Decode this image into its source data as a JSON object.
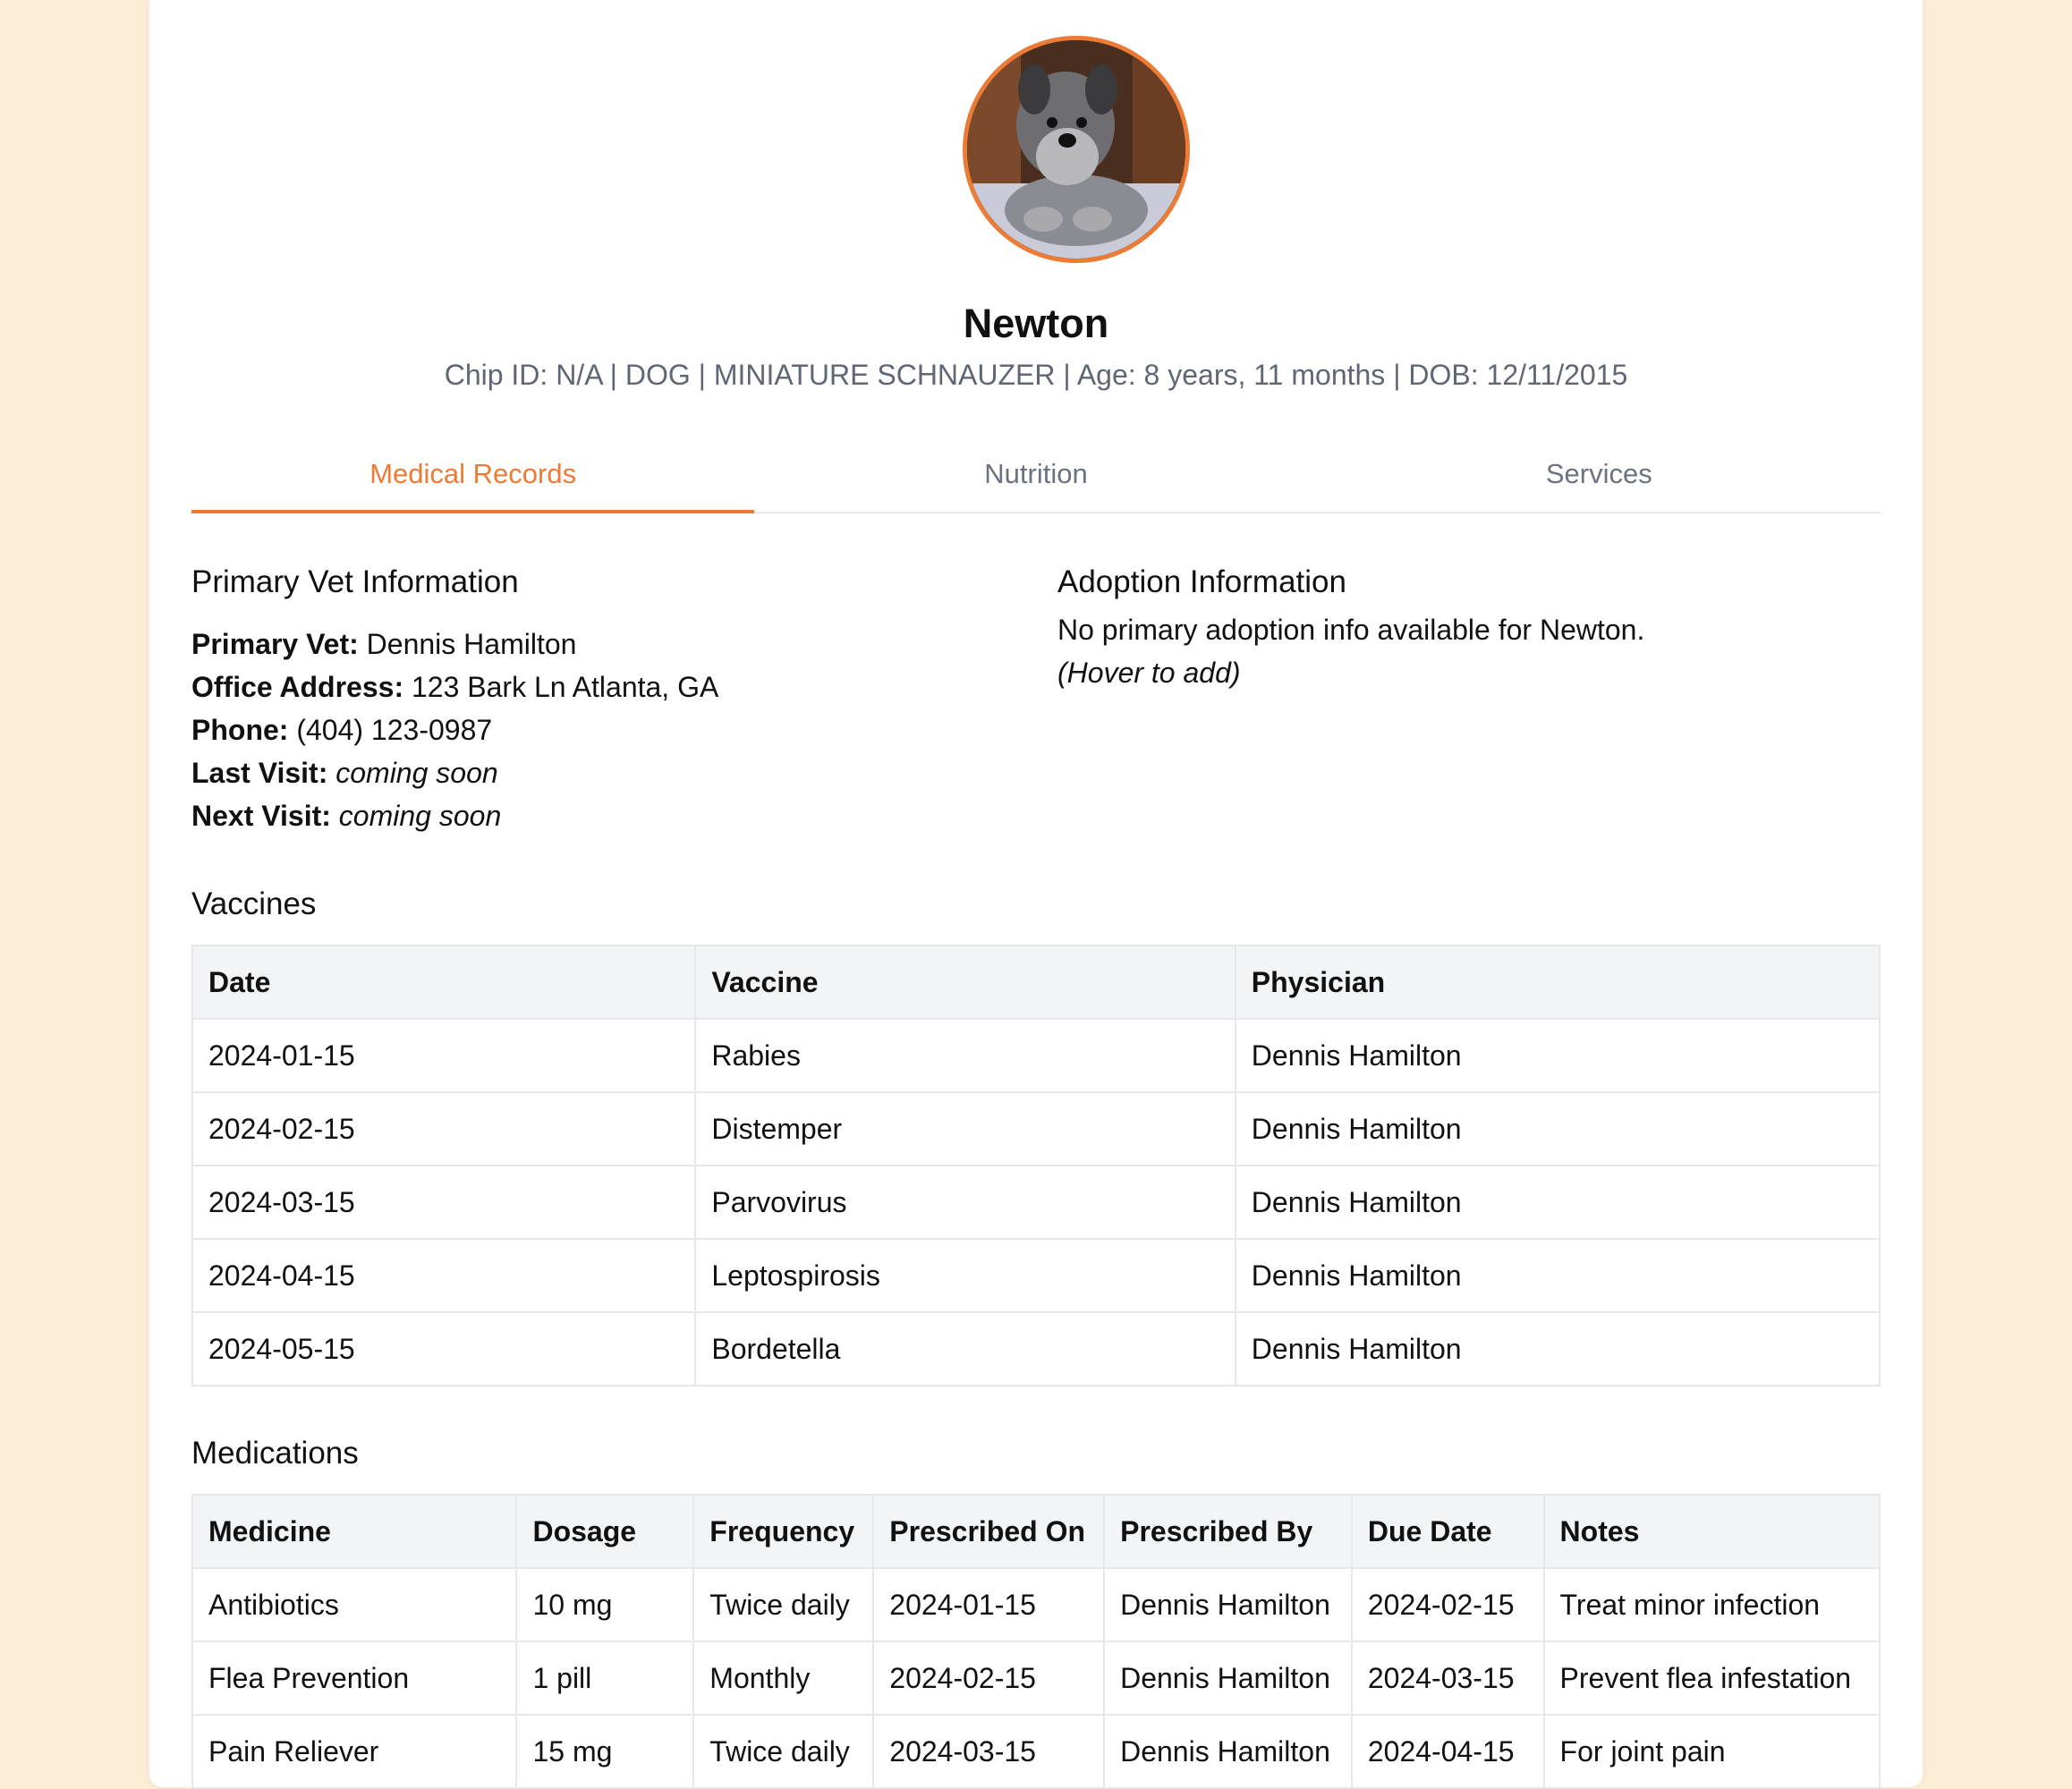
{
  "profile": {
    "name": "Newton",
    "meta": "Chip ID: N/A | DOG | MINIATURE SCHNAUZER | Age: 8 years, 11 months | DOB: 12/11/2015"
  },
  "tabs": [
    {
      "label": "Medical Records",
      "active": true
    },
    {
      "label": "Nutrition",
      "active": false
    },
    {
      "label": "Services",
      "active": false
    }
  ],
  "vet": {
    "title": "Primary Vet Information",
    "rows": [
      {
        "label": "Primary Vet:",
        "value": "Dennis Hamilton",
        "italic": false
      },
      {
        "label": "Office Address:",
        "value": "123 Bark Ln Atlanta, GA",
        "italic": false
      },
      {
        "label": "Phone:",
        "value": "(404) 123-0987",
        "italic": false
      },
      {
        "label": "Last Visit:",
        "value": "coming soon",
        "italic": true
      },
      {
        "label": "Next Visit:",
        "value": "coming soon",
        "italic": true
      }
    ]
  },
  "adoption": {
    "title": "Adoption Information",
    "message": "No primary adoption info available for Newton.",
    "hint": "(Hover to add)"
  },
  "vaccines": {
    "title": "Vaccines",
    "headers": [
      "Date",
      "Vaccine",
      "Physician"
    ],
    "rows": [
      [
        "2024-01-15",
        "Rabies",
        "Dennis Hamilton"
      ],
      [
        "2024-02-15",
        "Distemper",
        "Dennis Hamilton"
      ],
      [
        "2024-03-15",
        "Parvovirus",
        "Dennis Hamilton"
      ],
      [
        "2024-04-15",
        "Leptospirosis",
        "Dennis Hamilton"
      ],
      [
        "2024-05-15",
        "Bordetella",
        "Dennis Hamilton"
      ]
    ]
  },
  "medications": {
    "title": "Medications",
    "headers": [
      "Medicine",
      "Dosage",
      "Frequency",
      "Prescribed On",
      "Prescribed By",
      "Due Date",
      "Notes"
    ],
    "rows": [
      [
        "Antibiotics",
        "10 mg",
        "Twice daily",
        "2024-01-15",
        "Dennis Hamilton",
        "2024-02-15",
        "Treat minor infection"
      ],
      [
        "Flea Prevention",
        "1 pill",
        "Monthly",
        "2024-02-15",
        "Dennis Hamilton",
        "2024-03-15",
        "Prevent flea infestation"
      ],
      [
        "Pain Reliever",
        "15 mg",
        "Twice daily",
        "2024-03-15",
        "Dennis Hamilton",
        "2024-04-15",
        "For joint pain"
      ]
    ]
  },
  "colors": {
    "accent": "#ec7b35",
    "page_bg": "#fdeed8",
    "muted_text": "#5f6675"
  }
}
